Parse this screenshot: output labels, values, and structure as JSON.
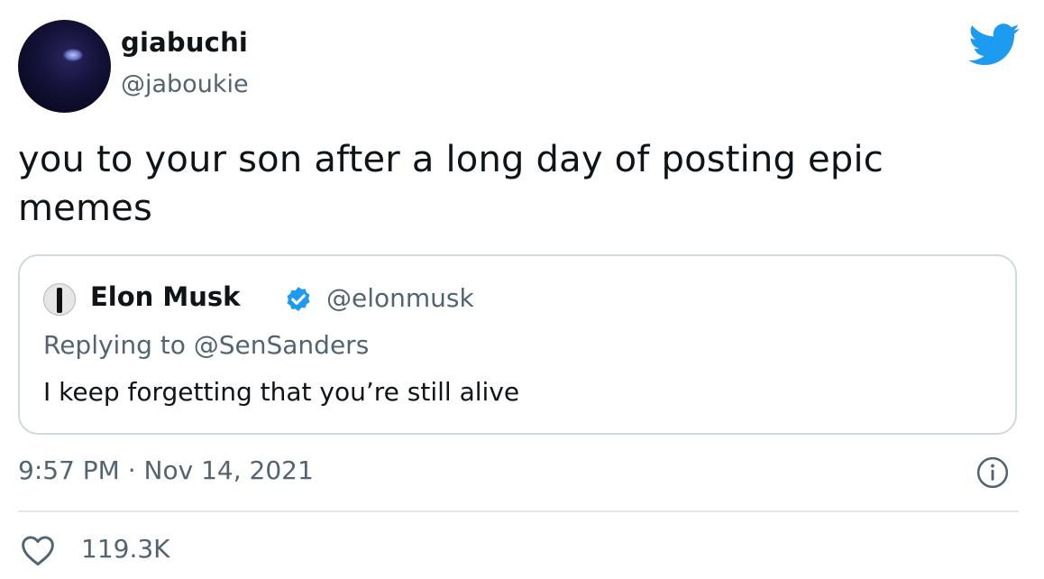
{
  "author": {
    "display_name": "giabuchi",
    "handle": "@jaboukie"
  },
  "tweet": {
    "text": "you to your son after a long day of posting epic memes",
    "timestamp": "9:57 PM · Nov 14, 2021",
    "like_count": "119.3K"
  },
  "quoted_tweet": {
    "display_name": "Elon Musk",
    "handle": "@elonmusk",
    "verified": true,
    "reply_to": "Replying to @SenSanders",
    "text": "I keep forgetting that you’re still alive"
  },
  "icons": {
    "brand": "twitter-bird-icon",
    "verified": "verified-badge-icon",
    "info": "info-icon",
    "like": "heart-icon"
  },
  "colors": {
    "twitter_blue": "#1d9bf0",
    "secondary_text": "#536471",
    "border": "#cfd9de"
  }
}
